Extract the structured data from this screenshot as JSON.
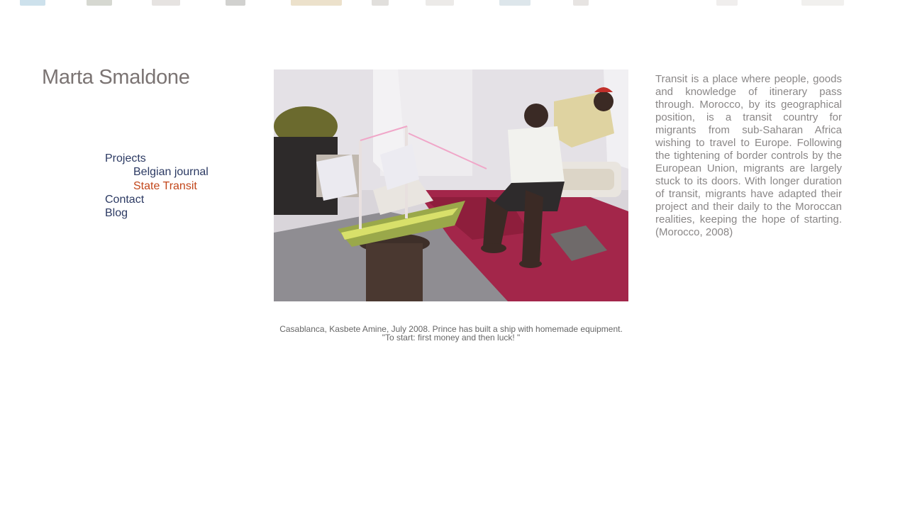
{
  "site": {
    "title": "Marta Smaldone"
  },
  "nav": {
    "projects": "Projects",
    "belgian_journal": "Belgian journal",
    "state_transit": "State Transit",
    "contact": "Contact",
    "blog": "Blog",
    "active_color": "#c2461a",
    "link_color": "#2c3a63"
  },
  "photo": {
    "caption_line1": "Casablanca, Kasbete Amine, July 2008. Prince has built a ship with homemade equipment.",
    "caption_line2": "\"To start: first money and then luck! \""
  },
  "project": {
    "description": "Transit is a place where people, goods and knowledge of itinerary pass through. Morocco, by its geographical position, is a transit country for migrants from sub-Saharan Africa wishing to travel to Europe. Following the tightening of border controls by the European Union, migrants are largely stuck to its doors. With longer duration of transit, migrants have adapted their project and their daily to the Moroccan realities, keeping the hope of starting. (Morocco, 2008)"
  }
}
